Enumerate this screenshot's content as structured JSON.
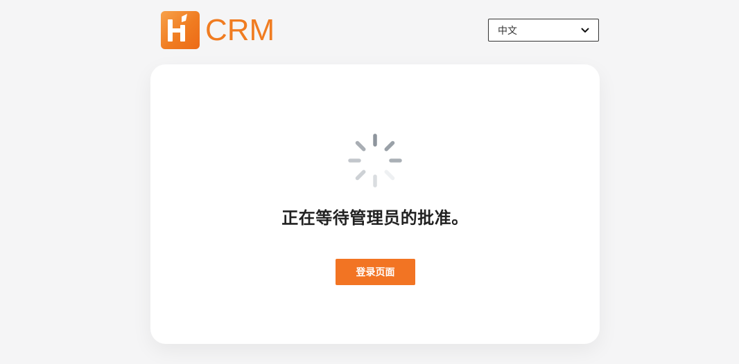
{
  "brand": {
    "logo_icon": "hcrm-h-logo-icon",
    "name": "CRM",
    "color": "#f07c21"
  },
  "language_select": {
    "selected": "中文",
    "icon": "chevron-down-icon"
  },
  "status": {
    "icon": "loading-spinner-icon",
    "message": "正在等待管理员的批准。"
  },
  "actions": {
    "login_label": "登录页面",
    "button_color": "#f27423"
  }
}
